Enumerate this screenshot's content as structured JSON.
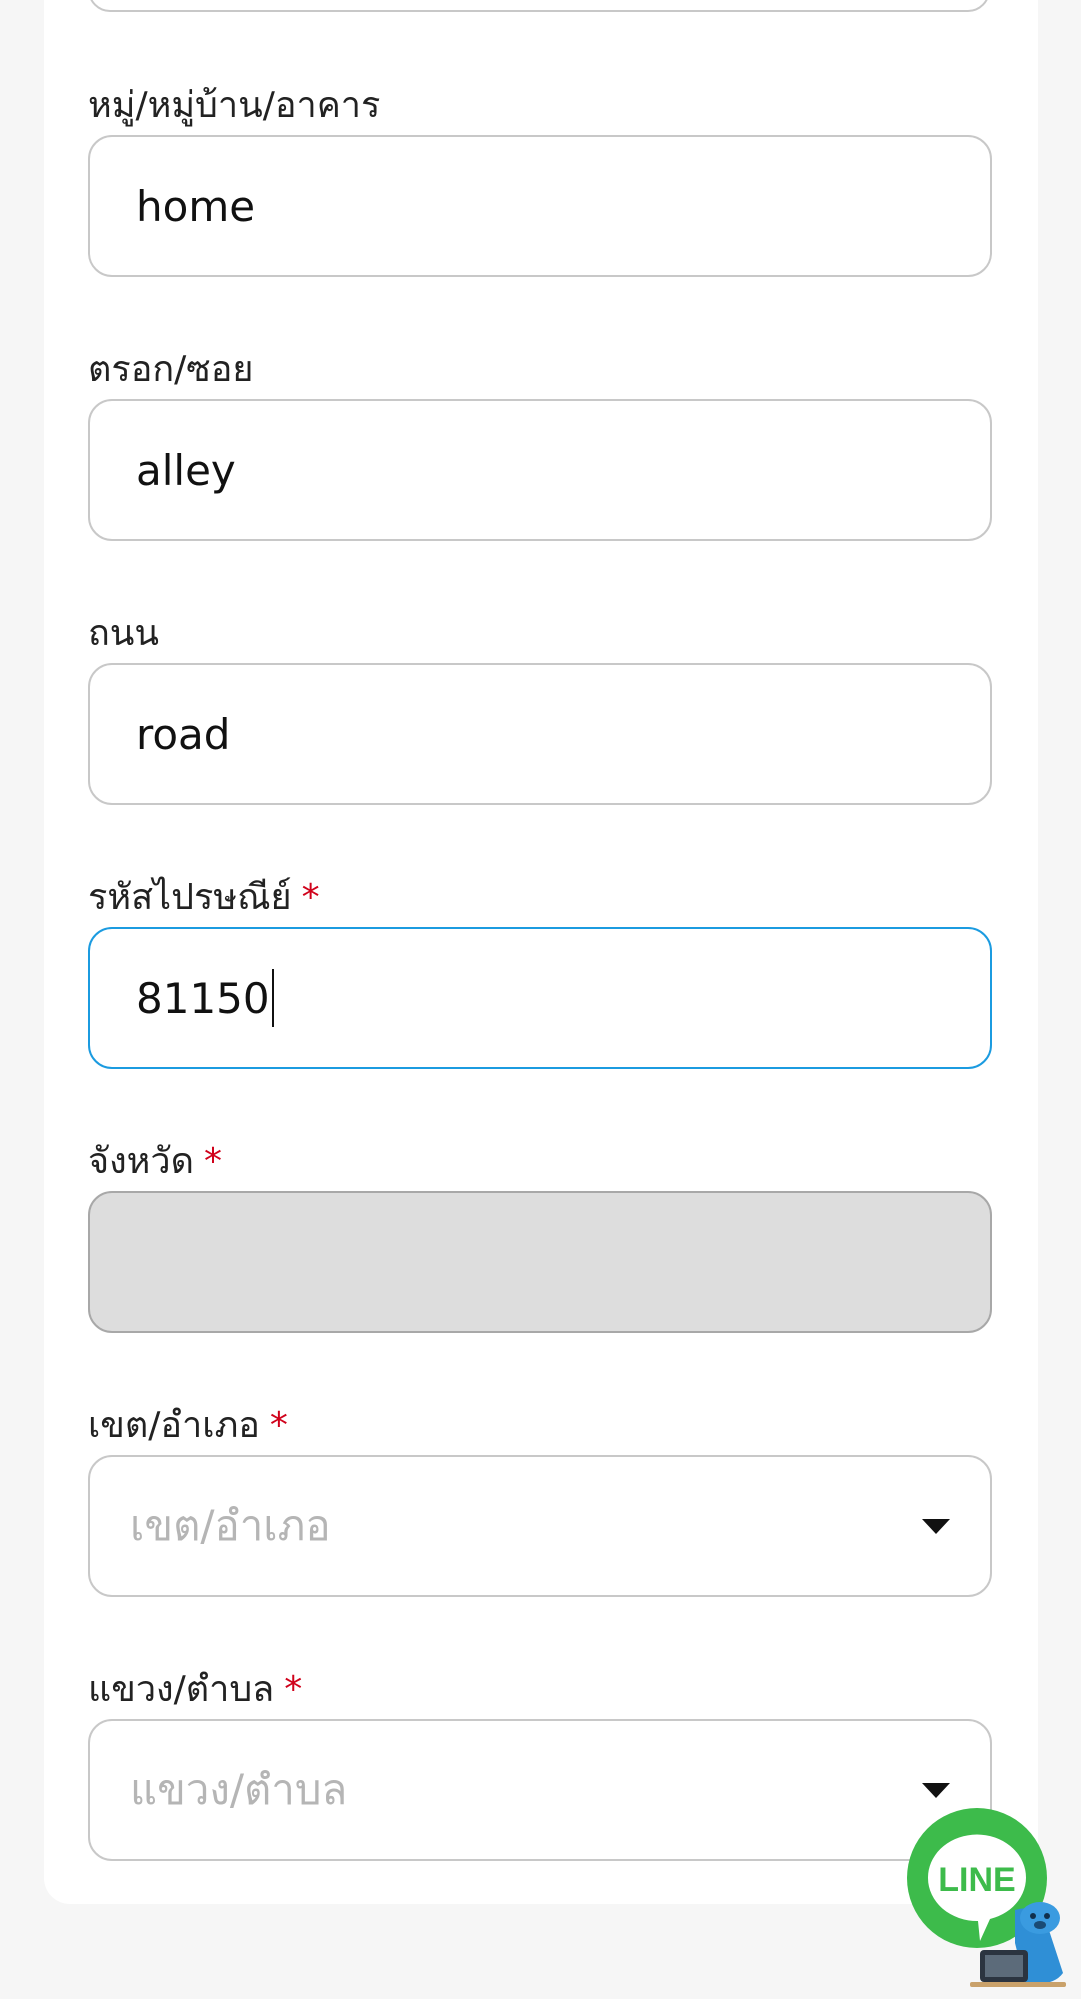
{
  "form": {
    "village": {
      "label": "หมู่/หมู่บ้าน/อาคาร",
      "value": "home"
    },
    "alley": {
      "label": "ตรอก/ซอย",
      "value": "alley"
    },
    "road": {
      "label": "ถนน",
      "value": "road"
    },
    "postal": {
      "label": "รหัสไปรษณีย์",
      "required_mark": "*",
      "value": "81150"
    },
    "province": {
      "label": "จังหวัด",
      "required_mark": "*",
      "value": ""
    },
    "district": {
      "label": "เขต/อำเภอ",
      "required_mark": "*",
      "placeholder": "เขต/อำเภอ"
    },
    "subdistrict": {
      "label": "แขวง/ตำบล",
      "required_mark": "*",
      "placeholder": "แขวง/ตำบล"
    }
  },
  "line_widget": {
    "text": "LINE",
    "color": "#3dbb4b"
  },
  "colors": {
    "focus": "#1b9be0",
    "required": "#d0021b",
    "disabled": "#dddddd"
  }
}
